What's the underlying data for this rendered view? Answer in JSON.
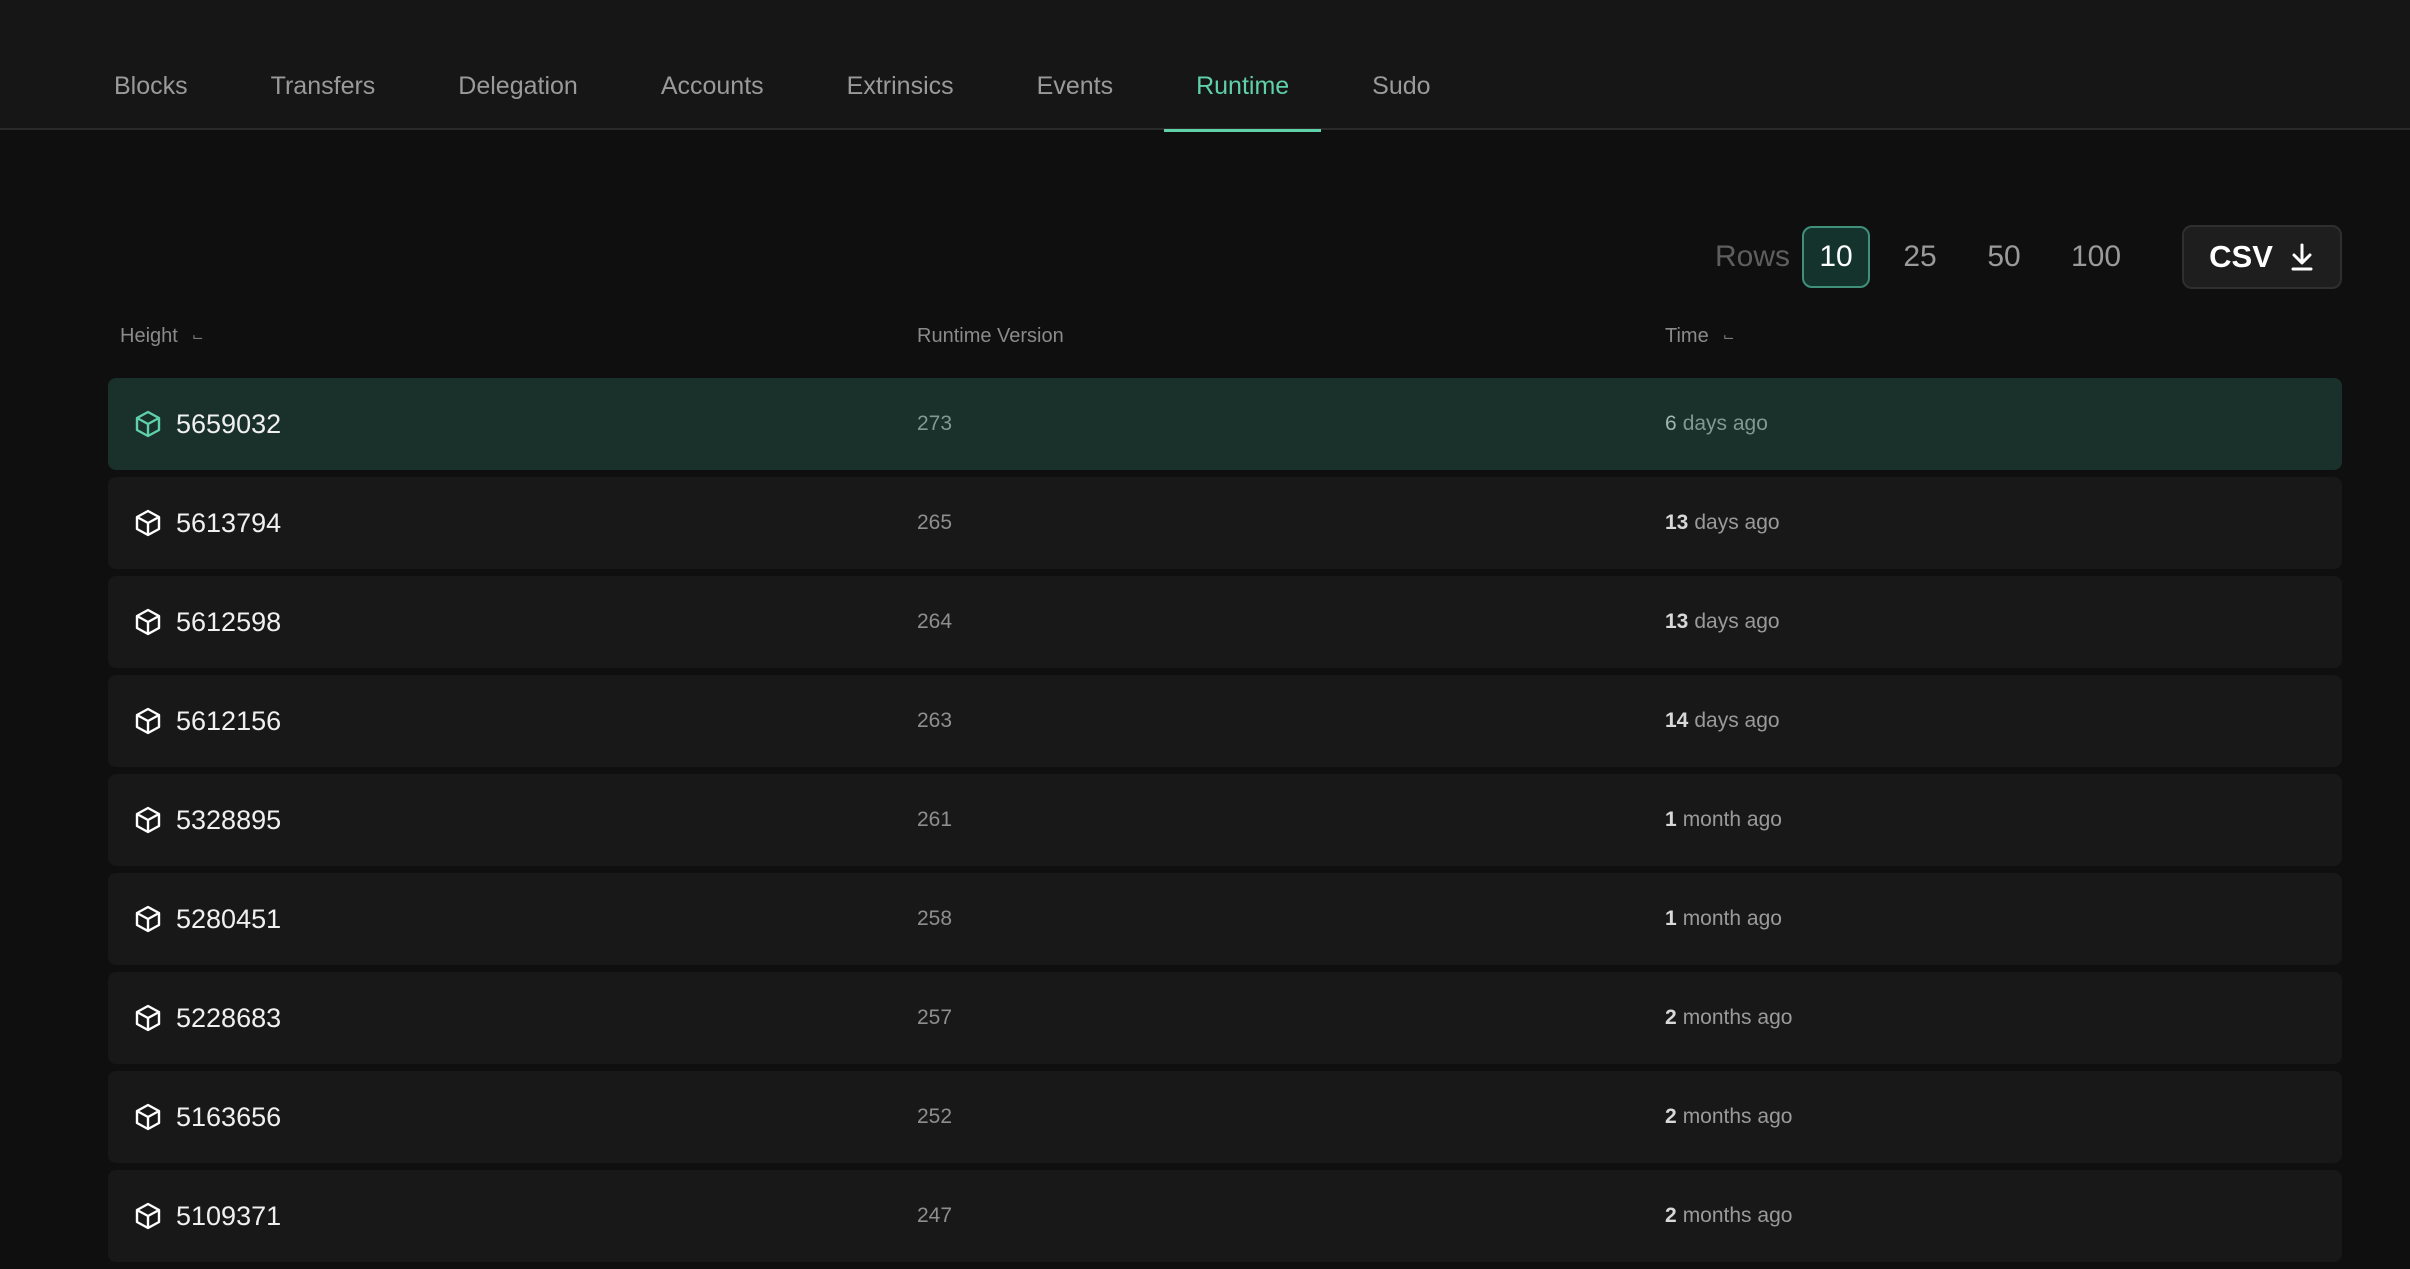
{
  "nav": {
    "tabs": [
      {
        "label": "Blocks",
        "active": false
      },
      {
        "label": "Transfers",
        "active": false
      },
      {
        "label": "Delegation",
        "active": false
      },
      {
        "label": "Accounts",
        "active": false
      },
      {
        "label": "Extrinsics",
        "active": false
      },
      {
        "label": "Events",
        "active": false
      },
      {
        "label": "Runtime",
        "active": true
      },
      {
        "label": "Sudo",
        "active": false
      }
    ]
  },
  "pagination": {
    "rows_label": "Rows",
    "options": [
      "10",
      "25",
      "50",
      "100"
    ],
    "selected": "10"
  },
  "export": {
    "csv_label": "CSV",
    "icon": "download-icon"
  },
  "table": {
    "headers": {
      "height": "Height",
      "runtime_version": "Runtime Version",
      "time": "Time"
    },
    "rows": [
      {
        "height": "5659032",
        "version": "273",
        "time_num": "6",
        "time_unit": "days ago",
        "highlight": true
      },
      {
        "height": "5613794",
        "version": "265",
        "time_num": "13",
        "time_unit": "days ago"
      },
      {
        "height": "5612598",
        "version": "264",
        "time_num": "13",
        "time_unit": "days ago"
      },
      {
        "height": "5612156",
        "version": "263",
        "time_num": "14",
        "time_unit": "days ago"
      },
      {
        "height": "5328895",
        "version": "261",
        "time_num": "1",
        "time_unit": "month ago"
      },
      {
        "height": "5280451",
        "version": "258",
        "time_num": "1",
        "time_unit": "month ago"
      },
      {
        "height": "5228683",
        "version": "257",
        "time_num": "2",
        "time_unit": "months ago"
      },
      {
        "height": "5163656",
        "version": "252",
        "time_num": "2",
        "time_unit": "months ago"
      },
      {
        "height": "5109371",
        "version": "247",
        "time_num": "2",
        "time_unit": "months ago"
      }
    ]
  },
  "colors": {
    "accent": "#5fd0a8",
    "background": "#0f0f0f",
    "row_background": "#181818",
    "row_highlight": "#19302b"
  }
}
